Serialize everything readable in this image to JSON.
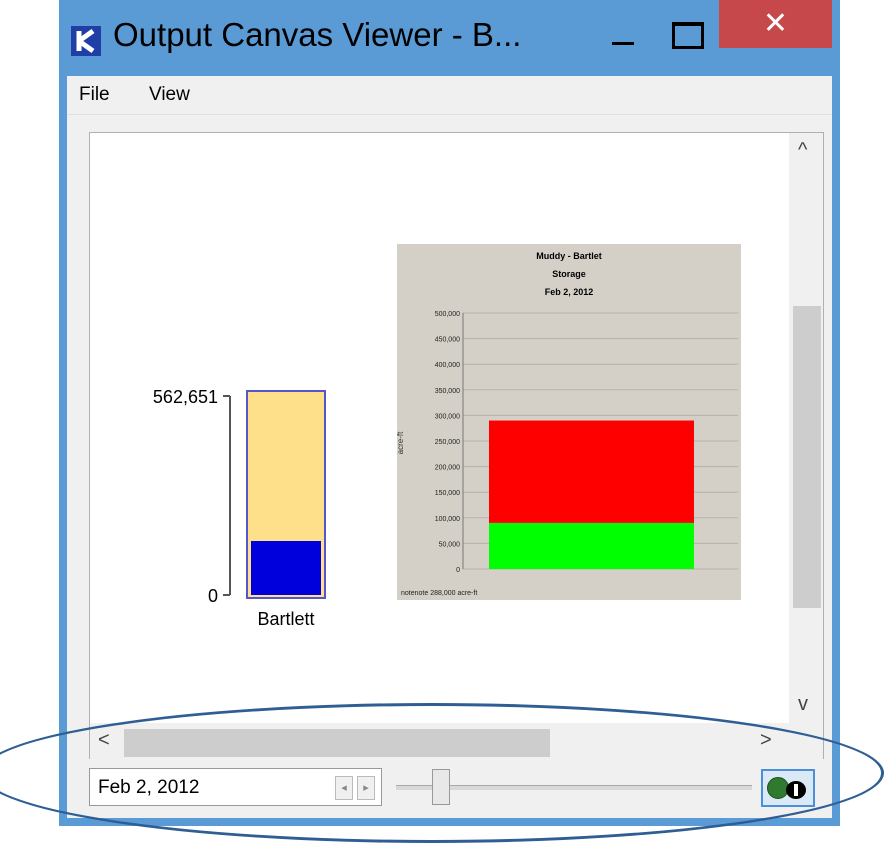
{
  "window": {
    "title": "Output Canvas Viewer - B...",
    "minimize_icon": "minimize-icon",
    "maximize_icon": "maximize-icon",
    "close_label": "✕"
  },
  "menu": {
    "items": [
      {
        "label": "File"
      },
      {
        "label": "View"
      }
    ]
  },
  "gauge": {
    "max_label": "562,651",
    "min_label": "0",
    "name": "Bartlett",
    "fill_fraction": 0.27
  },
  "chart_data": {
    "type": "bar",
    "title": "Muddy - Bartlet",
    "subtitle": "Storage",
    "date": "Feb 2, 2012",
    "ylabel": "acre-ft",
    "ylim": [
      0,
      500000
    ],
    "yticks": [
      "500,000",
      "450,000",
      "400,000",
      "350,000",
      "300,000",
      "250,000",
      "200,000",
      "150,000",
      "100,000",
      "50,000",
      "0"
    ],
    "series": [
      {
        "values": [
          90000
        ],
        "color": "#00ff00"
      },
      {
        "values": [
          200000
        ],
        "color": "#ff0000"
      }
    ],
    "footnote": "notenote 288,000 acre-ft",
    "background": "#d4d0c8"
  },
  "controls": {
    "date_value": "Feb 2, 2012",
    "step_left": "◂",
    "step_right": "▸",
    "slider_position": 0.1
  },
  "colors": {
    "titlebar": "#5b9bd5",
    "close": "#c7484a",
    "gauge_fill": "#0000dd",
    "gauge_bg": "#ffe08a"
  }
}
